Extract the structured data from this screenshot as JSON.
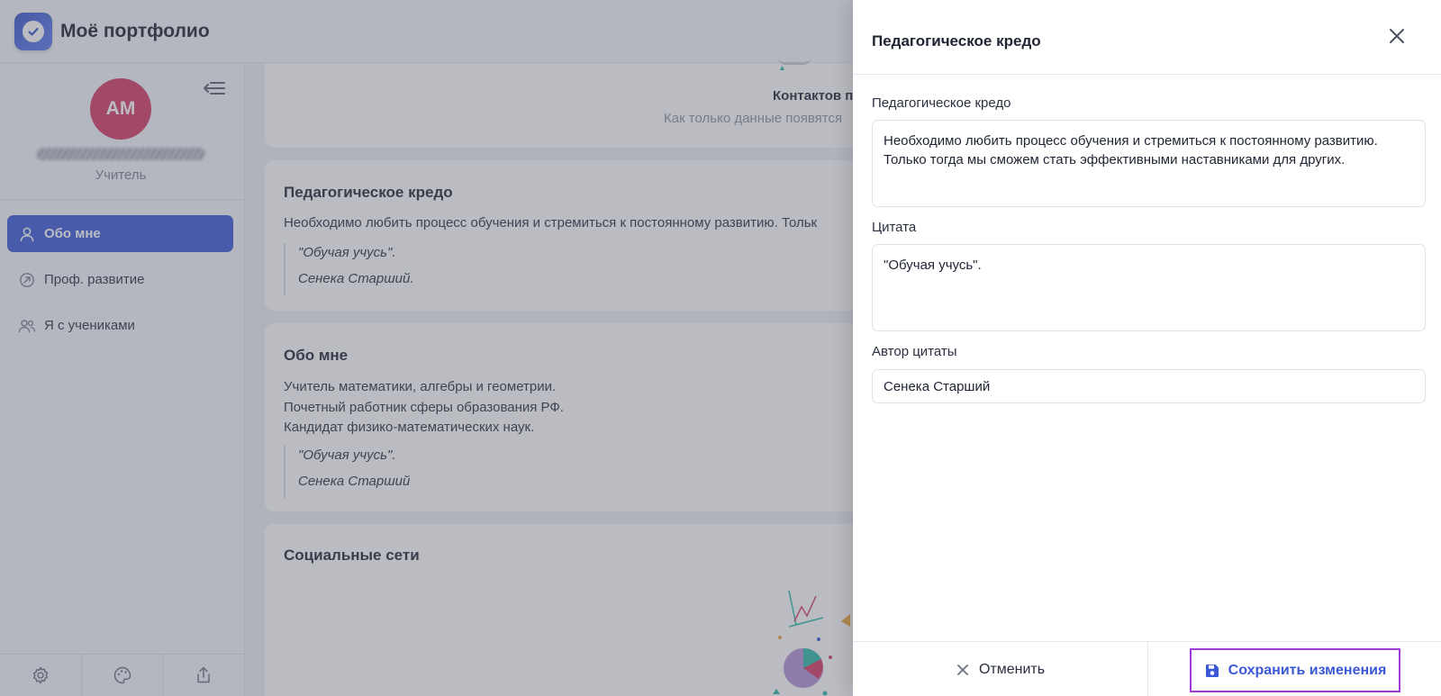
{
  "app": {
    "title": "Моё портфолио"
  },
  "sidebar": {
    "avatar_initials": "АМ",
    "user_role": "Учитель",
    "items": [
      {
        "label": "Обо мне",
        "icon": "user-icon",
        "active": true
      },
      {
        "label": "Проф. развитие",
        "icon": "growth-icon",
        "active": false
      },
      {
        "label": "Я с учениками",
        "icon": "users-icon",
        "active": false
      }
    ],
    "footer_icons": [
      "settings-icon",
      "palette-icon",
      "share-icon"
    ]
  },
  "main": {
    "contacts": {
      "title": "Контактов п",
      "subtitle": "Как только данные появятся"
    },
    "credo_card": {
      "title": "Педагогическое кредо",
      "text": "Необходимо любить процесс обучения и стремиться к постоянному развитию. Тольк",
      "quote": "\"Обучая учусь\".",
      "author": "Сенека Старший."
    },
    "about_card": {
      "title": "Обо мне",
      "lines": [
        "Учитель математики, алгебры и геометрии.",
        "Почетный работник сферы образования РФ.",
        "Кандидат физико-математических наук."
      ],
      "quote": "\"Обучая учусь\".",
      "author": "Сенека Старший"
    },
    "social_card": {
      "title": "Социальные сети"
    }
  },
  "drawer": {
    "title": "Педагогическое кредо",
    "fields": {
      "credo_label": "Педагогическое кредо",
      "credo_value": "Необходимо любить процесс обучения и стремиться к постоянному развитию.\nТолько тогда мы сможем стать эффективными наставниками для других.",
      "quote_label": "Цитата",
      "quote_value": "\"Обучая учусь\".",
      "author_label": "Автор цитаты",
      "author_value": "Сенека Старший"
    },
    "cancel_label": "Отменить",
    "save_label": "Сохранить изменения"
  },
  "colors": {
    "accent": "#3b58d6",
    "avatar": "#d63a64",
    "highlight_border": "#9b3dd6"
  }
}
